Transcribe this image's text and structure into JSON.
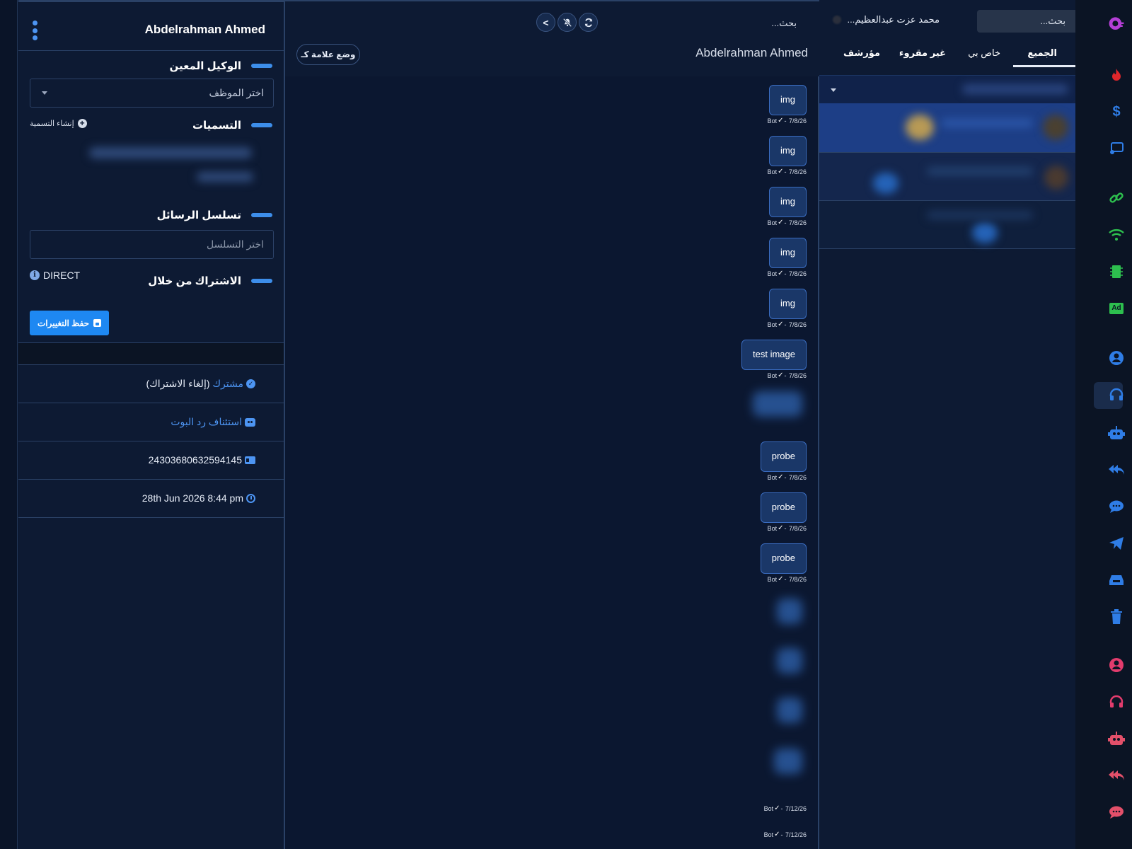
{
  "details": {
    "contact_name": "Abdelrahman Ahmed",
    "assigned_agent": {
      "title": "الوكيل المعين",
      "placeholder": "اختر الموظف"
    },
    "labels": {
      "title": "التسميات",
      "create_label": "إنشاء التسمية"
    },
    "sequence": {
      "title": "تسلسل الرسائل",
      "placeholder": "اختر التسلسل"
    },
    "subscribed_via": {
      "title": "الاشتراك من خلال",
      "value": "DIRECT"
    },
    "save_button": "حفظ التغييرات",
    "status": {
      "subscribed": "مشترك",
      "unsubscribe": "(إلغاء الاشتراك)"
    },
    "resume_bot": "استئناف رد البوت",
    "subscriber_id": "24303680632594145",
    "subscribed_date": "28th Jun 2026 8:44 pm"
  },
  "chat": {
    "search_placeholder": "بحث...",
    "contact_name": "Abdelrahman Ahmed",
    "mark_button": "وضع علامة كـ",
    "controls": {
      "send": "<"
    },
    "messages": [
      {
        "text": "img",
        "sender": "Bot",
        "date": "7/8/26"
      },
      {
        "text": "img",
        "sender": "Bot",
        "date": "7/8/26"
      },
      {
        "text": "img",
        "sender": "Bot",
        "date": "7/8/26"
      },
      {
        "text": "img",
        "sender": "Bot",
        "date": "7/8/26"
      },
      {
        "text": "img",
        "sender": "Bot",
        "date": "7/8/26"
      },
      {
        "text": "test image",
        "sender": "Bot",
        "date": "7/8/26"
      },
      {
        "text": "probe",
        "sender": "Bot",
        "date": "7/8/26"
      },
      {
        "text": "probe",
        "sender": "Bot",
        "date": "7/8/26"
      },
      {
        "text": "probe",
        "sender": "Bot",
        "date": "7/8/26"
      }
    ],
    "tail_meta": [
      {
        "sender": "Bot",
        "date": "7/12/26"
      },
      {
        "sender": "Bot",
        "date": "7/12/26"
      }
    ]
  },
  "conversations": {
    "search_placeholder": "بحث...",
    "agent_name": "محمد عزت عبدالعظيم...",
    "tabs": [
      "الجميع",
      "خاص بي",
      "غير مقروء",
      "مؤرشف"
    ]
  },
  "sidebar": {
    "icons": [
      "logo-icon",
      "fire-icon",
      "dollar-icon",
      "broadcast-icon",
      "link-icon",
      "wifi-icon",
      "chip-icon",
      "ad-icon",
      "user-icon",
      "headset-icon",
      "robot-icon",
      "reply-all-icon",
      "comment-icon",
      "send-icon",
      "inbox-icon",
      "trash-icon",
      "user-icon",
      "headset-icon",
      "robot-icon",
      "reply-all-icon",
      "comment-icon"
    ],
    "ad_text": "Ad"
  },
  "colors": {
    "accent": "#1e88f2",
    "bubble": "#1a3768",
    "panel": "#0d1a33"
  }
}
